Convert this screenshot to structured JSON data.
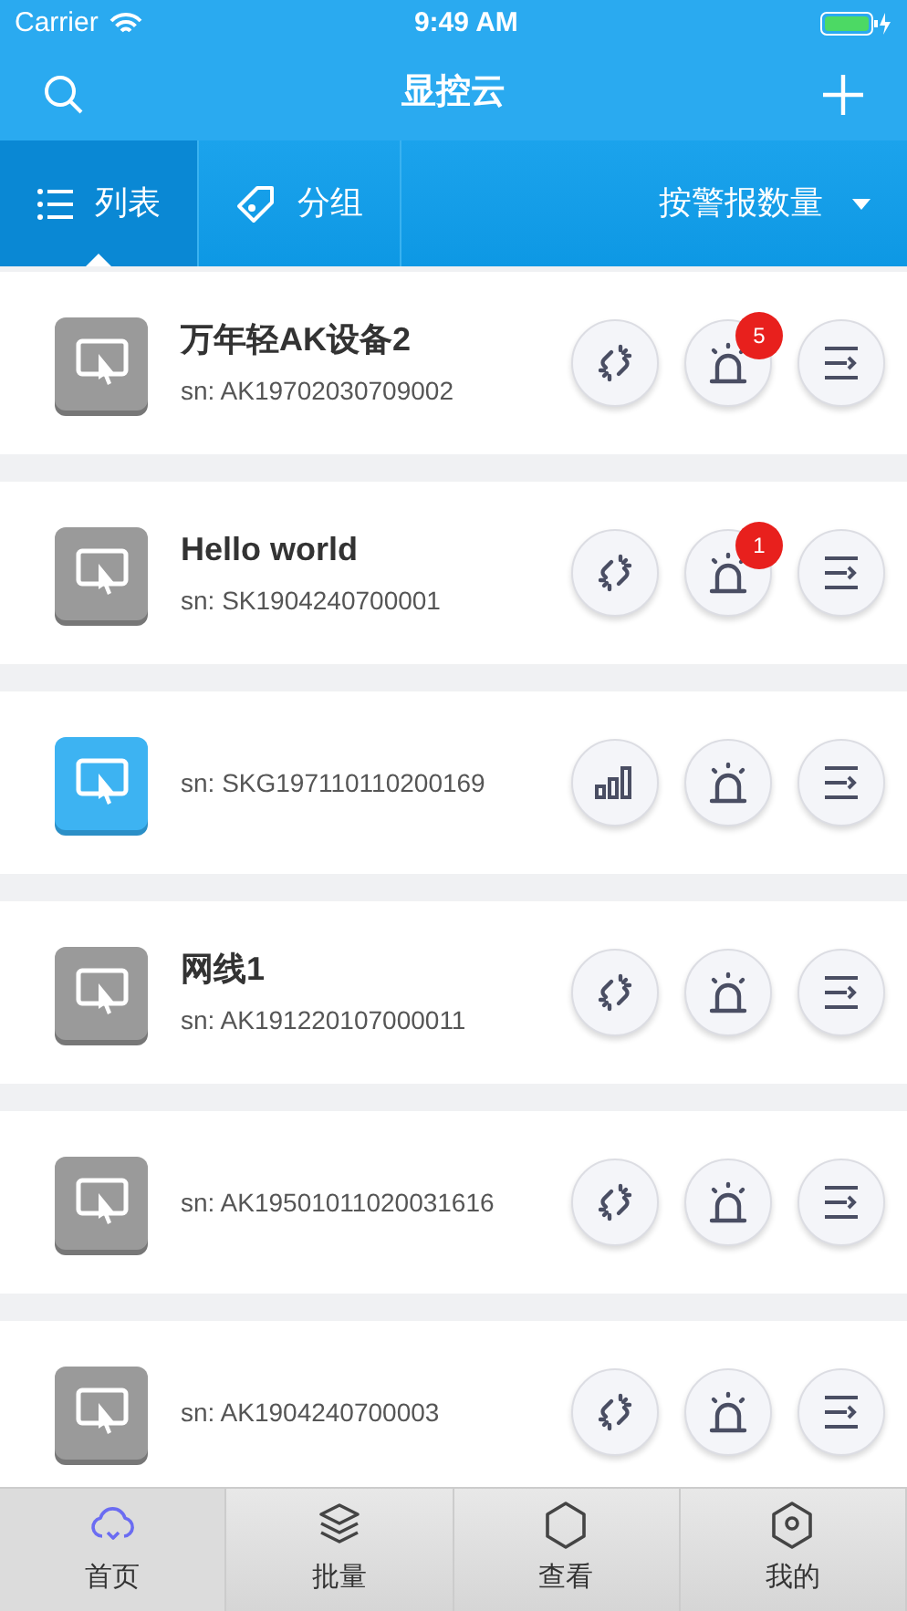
{
  "status_bar": {
    "carrier": "Carrier",
    "time": "9:49 AM"
  },
  "nav": {
    "title": "显控云"
  },
  "view_tabs": [
    {
      "label": "列表",
      "selected": true,
      "kind": "list"
    },
    {
      "label": "分组",
      "selected": false,
      "kind": "tag"
    }
  ],
  "sort": {
    "label": "按警报数量"
  },
  "devices": [
    {
      "name": "万年轻AK设备2",
      "sn": "sn: AK19702030709002",
      "online": false,
      "kind": "unlink",
      "alarms": "5"
    },
    {
      "name": "Hello world",
      "sn": "sn: SK1904240700001",
      "online": false,
      "kind": "unlink",
      "alarms": "1"
    },
    {
      "sn": "sn: SKG197110110200169",
      "online": true,
      "kind": "signal"
    },
    {
      "name": "网线1",
      "sn": "sn: AK191220107000011",
      "online": false,
      "kind": "unlink"
    },
    {
      "sn": "sn: AK19501011020031616",
      "online": false,
      "kind": "unlink"
    },
    {
      "sn": "sn: AK1904240700003",
      "online": false,
      "kind": "unlink"
    }
  ],
  "tab_bar": [
    {
      "label": "首页",
      "selected": true,
      "kind": "cloud"
    },
    {
      "label": "批量",
      "selected": false,
      "kind": "layers"
    },
    {
      "label": "查看",
      "selected": false,
      "kind": "hex"
    },
    {
      "label": "我的",
      "selected": false,
      "kind": "user"
    }
  ]
}
